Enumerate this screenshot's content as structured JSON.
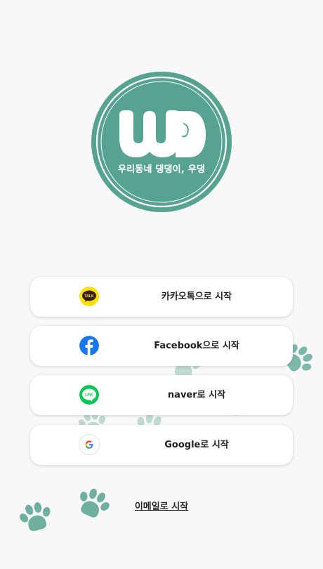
{
  "brand": {
    "logo_text": "WD",
    "tagline": "우리동네 댕댕이, 우댕",
    "color": "#56a391"
  },
  "login": {
    "buttons": [
      {
        "label": "카카오톡으로 시작",
        "icon": "kakaotalk-icon",
        "icon_text": "TALK",
        "color": "#fae100"
      },
      {
        "label": "Facebook으로 시작",
        "icon": "facebook-icon",
        "icon_text": "f",
        "color": "#1877f2"
      },
      {
        "label": "naver로 시작",
        "icon": "line-icon",
        "icon_text": "LINE",
        "color": "#06c755"
      },
      {
        "label": "Google로 시작",
        "icon": "google-icon",
        "icon_text": "G",
        "color": "#ffffff"
      }
    ],
    "email_link": "이메일로 시작"
  },
  "decor": {
    "paw_color": "#56a391"
  }
}
